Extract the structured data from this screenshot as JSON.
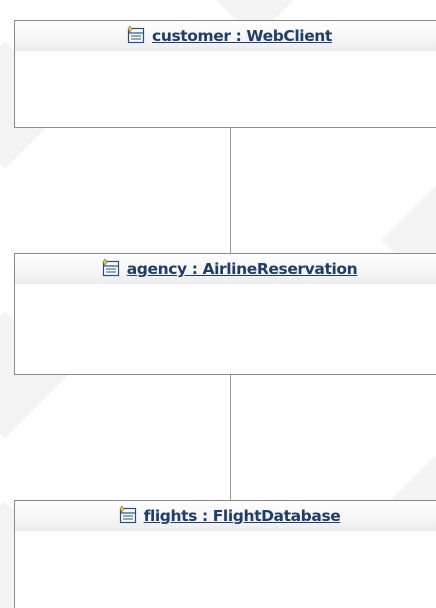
{
  "diagram": {
    "objects": [
      {
        "id": "customer",
        "label": "customer : WebClient",
        "icon": "class-instance-icon"
      },
      {
        "id": "agency",
        "label": "agency : AirlineReservation",
        "icon": "class-instance-icon"
      },
      {
        "id": "flights",
        "label": "flights : FlightDatabase",
        "icon": "class-instance-icon"
      }
    ],
    "links": [
      {
        "from": "customer",
        "to": "agency"
      },
      {
        "from": "agency",
        "to": "flights"
      }
    ],
    "colors": {
      "title": "#1c3d6e",
      "border": "#8a8a8a",
      "link": "#9a9a9a",
      "icon": "#1f4f8c"
    }
  }
}
